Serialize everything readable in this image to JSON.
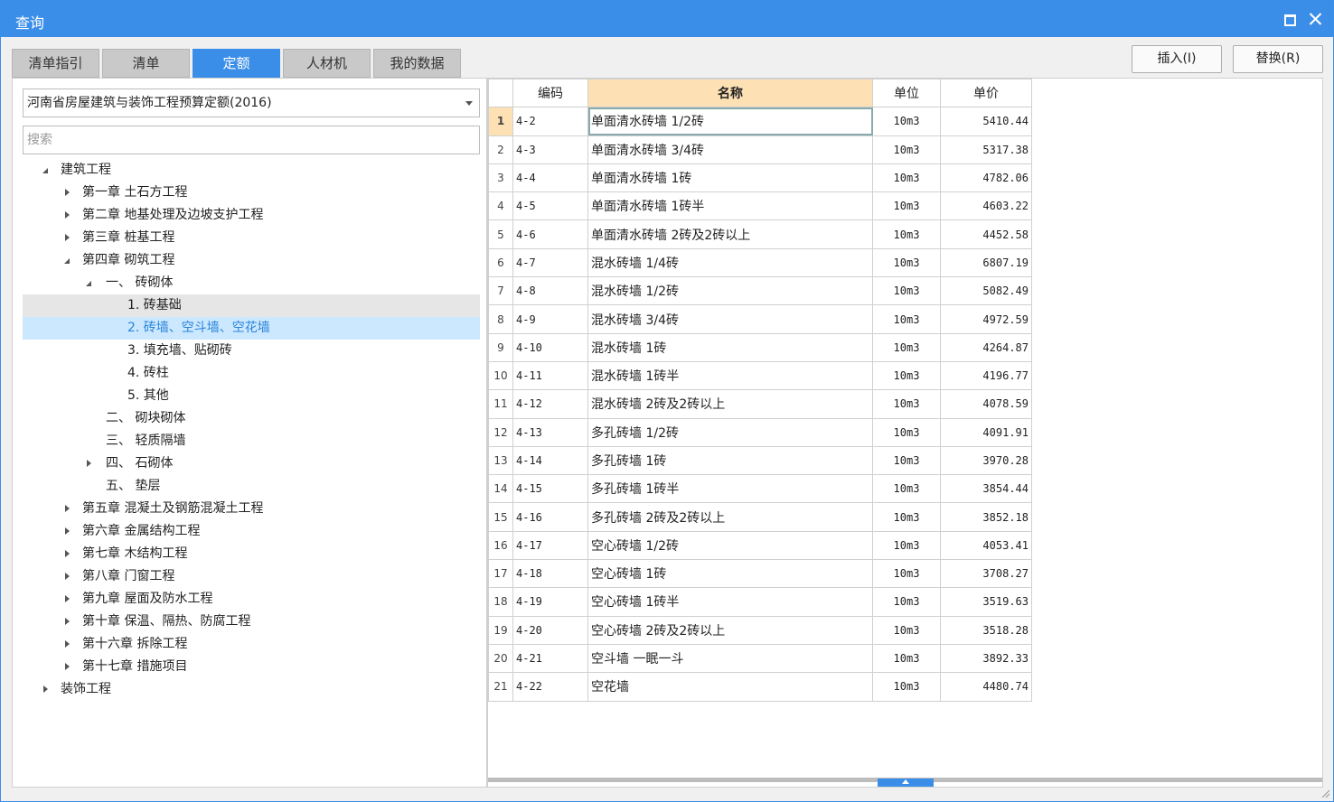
{
  "window": {
    "title": "查询"
  },
  "tabs": [
    {
      "label": "清单指引",
      "active": false
    },
    {
      "label": "清单",
      "active": false
    },
    {
      "label": "定额",
      "active": true
    },
    {
      "label": "人材机",
      "active": false
    },
    {
      "label": "我的数据",
      "active": false
    }
  ],
  "buttons": {
    "insert": "插入(I)",
    "replace": "替换(R)"
  },
  "library": {
    "selected": "河南省房屋建筑与装饰工程预算定额(2016)"
  },
  "search": {
    "placeholder": "搜索",
    "value": ""
  },
  "tree": [
    {
      "label": "建筑工程",
      "level": 0,
      "toggle": "expanded"
    },
    {
      "label": "第一章 土石方工程",
      "level": 1,
      "toggle": "collapsed"
    },
    {
      "label": "第二章 地基处理及边坡支护工程",
      "level": 1,
      "toggle": "collapsed"
    },
    {
      "label": "第三章 桩基工程",
      "level": 1,
      "toggle": "collapsed"
    },
    {
      "label": "第四章 砌筑工程",
      "level": 1,
      "toggle": "expanded"
    },
    {
      "label": "一、 砖砌体",
      "level": 2,
      "toggle": "expanded"
    },
    {
      "label": "1. 砖基础",
      "level": 3,
      "toggle": "none",
      "state": "hover"
    },
    {
      "label": "2. 砖墙、空斗墙、空花墙",
      "level": 3,
      "toggle": "none",
      "state": "selected"
    },
    {
      "label": "3. 填充墙、贴砌砖",
      "level": 3,
      "toggle": "none"
    },
    {
      "label": "4. 砖柱",
      "level": 3,
      "toggle": "none"
    },
    {
      "label": "5. 其他",
      "level": 3,
      "toggle": "none"
    },
    {
      "label": "二、 砌块砌体",
      "level": 2,
      "toggle": "none"
    },
    {
      "label": "三、 轻质隔墙",
      "level": 2,
      "toggle": "none"
    },
    {
      "label": "四、 石砌体",
      "level": 2,
      "toggle": "collapsed"
    },
    {
      "label": "五、 垫层",
      "level": 2,
      "toggle": "none"
    },
    {
      "label": "第五章 混凝土及钢筋混凝土工程",
      "level": 1,
      "toggle": "collapsed"
    },
    {
      "label": "第六章 金属结构工程",
      "level": 1,
      "toggle": "collapsed"
    },
    {
      "label": "第七章 木结构工程",
      "level": 1,
      "toggle": "collapsed"
    },
    {
      "label": "第八章 门窗工程",
      "level": 1,
      "toggle": "collapsed"
    },
    {
      "label": "第九章 屋面及防水工程",
      "level": 1,
      "toggle": "collapsed"
    },
    {
      "label": "第十章 保温、隔热、防腐工程",
      "level": 1,
      "toggle": "collapsed"
    },
    {
      "label": "第十六章 拆除工程",
      "level": 1,
      "toggle": "collapsed"
    },
    {
      "label": "第十七章 措施项目",
      "level": 1,
      "toggle": "collapsed"
    },
    {
      "label": "装饰工程",
      "level": 0,
      "toggle": "collapsed"
    }
  ],
  "grid": {
    "columns": [
      "编码",
      "名称",
      "单位",
      "单价"
    ],
    "rows": [
      {
        "num": "1",
        "code": "4-2",
        "name": "单面清水砖墙 1/2砖",
        "unit": "10m3",
        "price": "5410.44"
      },
      {
        "num": "2",
        "code": "4-3",
        "name": "单面清水砖墙 3/4砖",
        "unit": "10m3",
        "price": "5317.38"
      },
      {
        "num": "3",
        "code": "4-4",
        "name": "单面清水砖墙 1砖",
        "unit": "10m3",
        "price": "4782.06"
      },
      {
        "num": "4",
        "code": "4-5",
        "name": "单面清水砖墙 1砖半",
        "unit": "10m3",
        "price": "4603.22"
      },
      {
        "num": "5",
        "code": "4-6",
        "name": "单面清水砖墙 2砖及2砖以上",
        "unit": "10m3",
        "price": "4452.58"
      },
      {
        "num": "6",
        "code": "4-7",
        "name": "混水砖墙 1/4砖",
        "unit": "10m3",
        "price": "6807.19"
      },
      {
        "num": "7",
        "code": "4-8",
        "name": "混水砖墙 1/2砖",
        "unit": "10m3",
        "price": "5082.49"
      },
      {
        "num": "8",
        "code": "4-9",
        "name": "混水砖墙 3/4砖",
        "unit": "10m3",
        "price": "4972.59"
      },
      {
        "num": "9",
        "code": "4-10",
        "name": "混水砖墙 1砖",
        "unit": "10m3",
        "price": "4264.87"
      },
      {
        "num": "10",
        "code": "4-11",
        "name": "混水砖墙 1砖半",
        "unit": "10m3",
        "price": "4196.77"
      },
      {
        "num": "11",
        "code": "4-12",
        "name": "混水砖墙 2砖及2砖以上",
        "unit": "10m3",
        "price": "4078.59"
      },
      {
        "num": "12",
        "code": "4-13",
        "name": "多孔砖墙 1/2砖",
        "unit": "10m3",
        "price": "4091.91"
      },
      {
        "num": "13",
        "code": "4-14",
        "name": "多孔砖墙 1砖",
        "unit": "10m3",
        "price": "3970.28"
      },
      {
        "num": "14",
        "code": "4-15",
        "name": "多孔砖墙 1砖半",
        "unit": "10m3",
        "price": "3854.44"
      },
      {
        "num": "15",
        "code": "4-16",
        "name": "多孔砖墙 2砖及2砖以上",
        "unit": "10m3",
        "price": "3852.18"
      },
      {
        "num": "16",
        "code": "4-17",
        "name": "空心砖墙 1/2砖",
        "unit": "10m3",
        "price": "4053.41"
      },
      {
        "num": "17",
        "code": "4-18",
        "name": "空心砖墙 1砖",
        "unit": "10m3",
        "price": "3708.27"
      },
      {
        "num": "18",
        "code": "4-19",
        "name": "空心砖墙 1砖半",
        "unit": "10m3",
        "price": "3519.63"
      },
      {
        "num": "19",
        "code": "4-20",
        "name": "空心砖墙 2砖及2砖以上",
        "unit": "10m3",
        "price": "3518.28"
      },
      {
        "num": "20",
        "code": "4-21",
        "name": "空斗墙 一眠一斗",
        "unit": "10m3",
        "price": "3892.33"
      },
      {
        "num": "21",
        "code": "4-22",
        "name": "空花墙",
        "unit": "10m3",
        "price": "4480.74"
      }
    ]
  },
  "colors": {
    "accent": "#3b8ee8",
    "header_highlight": "#fde0b4",
    "tree_selected_bg": "#cce8ff",
    "tree_selected_text": "#2a84d8"
  },
  "icons": {
    "maximize": "maximize-icon",
    "close": "close-icon",
    "dropdown": "chevron-down-icon"
  }
}
